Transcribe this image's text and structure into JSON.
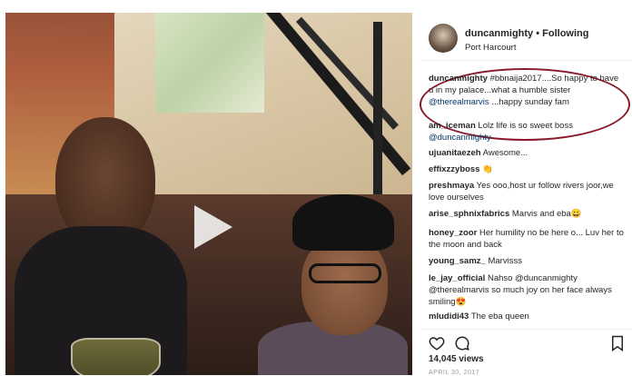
{
  "header": {
    "username": "duncanmighty",
    "separator": "•",
    "follow_status": "Following",
    "location": "Port Harcourt"
  },
  "caption": {
    "username": "duncanmighty",
    "text_before_mention": "#bbnaija2017....So happy to have u in my palace...what a humble sister",
    "mention": "@therealmarvis",
    "text_after_mention": "...happy sunday fam"
  },
  "comments": [
    {
      "username": "am_iceman",
      "text": "Lolz life is so sweet boss",
      "mention": "@duncanmighty"
    },
    {
      "username": "ujuanitaezeh",
      "text": "Awesome...",
      "mention": ""
    },
    {
      "username": "effixzzyboss",
      "text": "👏",
      "mention": ""
    },
    {
      "username": "preshmaya",
      "text": "Yes ooo,host ur follow rivers joor,we love ourselves",
      "mention": ""
    },
    {
      "username": "arise_sphnixfabrics",
      "text": "Marvis and eba😀",
      "mention": ""
    },
    {
      "username": "honey_zoor",
      "text": "Her humility no be here o... Luv her to the moon and back",
      "mention": ""
    },
    {
      "username": "young_samz_",
      "text": "Marvisss",
      "mention": ""
    },
    {
      "username": "le_jay_official",
      "text": "Nahso @duncanmighty @therealmarvis so much joy on her face always smiling😍",
      "mention": ""
    },
    {
      "username": "mludidi43",
      "text": "The eba queen",
      "mention": ""
    }
  ],
  "stats": {
    "views": "14,045 views",
    "date": "APRIL 30, 2017"
  },
  "colors": {
    "highlight_circle": "#8a1a2a",
    "mention": "#003569",
    "text": "#262626"
  },
  "icons": {
    "play": "play-icon",
    "like": "heart-icon",
    "comment": "comment-icon",
    "save": "bookmark-icon"
  }
}
